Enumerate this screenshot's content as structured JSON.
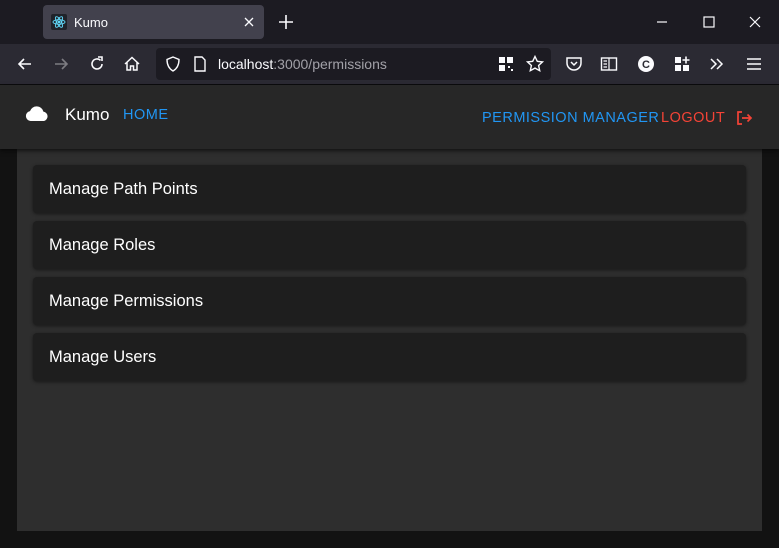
{
  "browser": {
    "tab_title": "Kumo",
    "url_host": "localhost",
    "url_rest": ":3000/permissions"
  },
  "app": {
    "brand": "Kumo",
    "nav": {
      "home": "HOME",
      "permission_manager": "PERMISSION MANAGER",
      "logout": "LOGOUT"
    },
    "items": [
      {
        "label": "Manage Path Points"
      },
      {
        "label": "Manage Roles"
      },
      {
        "label": "Manage Permissions"
      },
      {
        "label": "Manage Users"
      }
    ]
  },
  "colors": {
    "link_blue": "#2196f3",
    "logout_red": "#f44336"
  }
}
